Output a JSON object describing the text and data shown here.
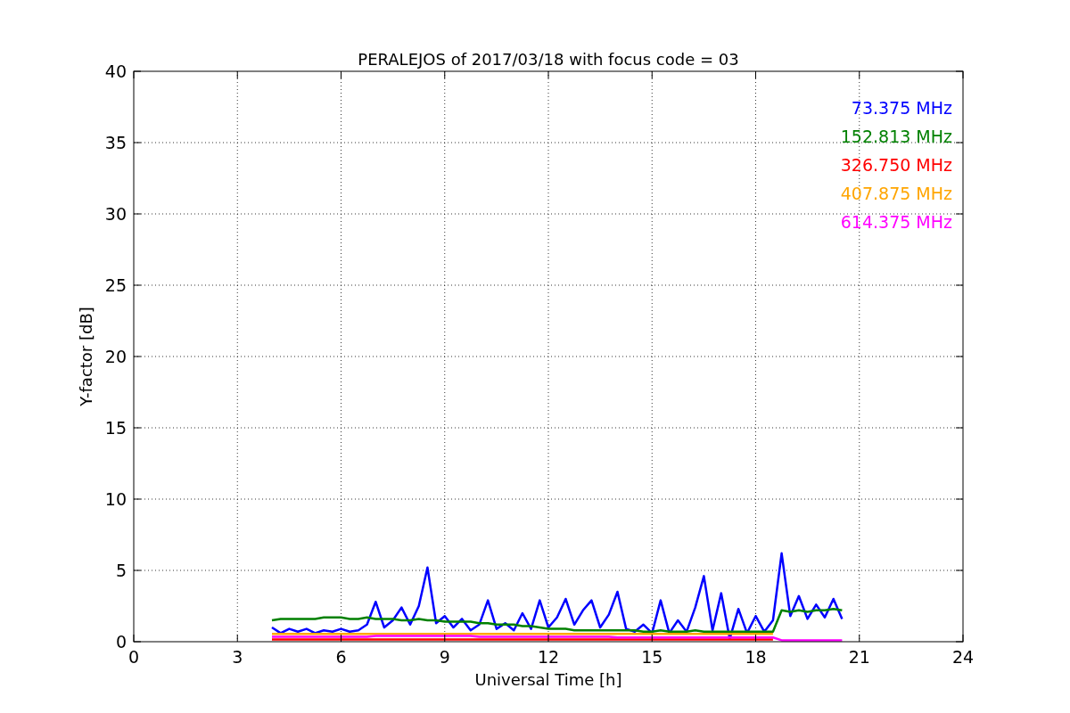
{
  "figure": {
    "chart_data": {
      "type": "line",
      "title": "PERALEJOS of 2017/03/18 with focus code = 03",
      "xlabel": "Universal Time [h]",
      "ylabel": "Y-factor [dB]",
      "x": [
        4,
        4.25,
        4.5,
        4.75,
        5,
        5.25,
        5.5,
        5.75,
        6,
        6.25,
        6.5,
        6.75,
        7,
        7.25,
        7.5,
        7.75,
        8,
        8.25,
        8.5,
        8.75,
        9,
        9.25,
        9.5,
        9.75,
        10,
        10.25,
        10.5,
        10.75,
        11,
        11.25,
        11.5,
        11.75,
        12,
        12.25,
        12.5,
        12.75,
        13,
        13.25,
        13.5,
        13.75,
        14,
        14.25,
        14.5,
        14.75,
        15,
        15.25,
        15.5,
        15.75,
        16,
        16.25,
        16.5,
        16.75,
        17,
        17.25,
        17.5,
        17.75,
        18,
        18.25,
        18.5,
        18.75,
        19,
        19.25,
        19.5,
        19.75,
        20,
        20.25,
        20.5
      ],
      "series": [
        {
          "name": "73.375 MHz",
          "color": "#0000ff",
          "values": [
            1.0,
            0.6,
            0.9,
            0.7,
            0.9,
            0.6,
            0.8,
            0.7,
            0.9,
            0.7,
            0.8,
            1.2,
            2.8,
            1.0,
            1.5,
            2.4,
            1.2,
            2.5,
            5.2,
            1.3,
            1.8,
            1.0,
            1.6,
            0.8,
            1.2,
            2.9,
            0.9,
            1.3,
            0.8,
            2.0,
            0.9,
            2.9,
            1.0,
            1.7,
            3.0,
            1.2,
            2.2,
            2.9,
            1.0,
            1.9,
            3.5,
            0.9,
            0.7,
            1.2,
            0.6,
            2.9,
            0.6,
            1.5,
            0.7,
            2.4,
            4.6,
            0.8,
            3.4,
            0.2,
            2.3,
            0.6,
            1.8,
            0.7,
            1.5,
            6.2,
            1.8,
            3.2,
            1.6,
            2.6,
            1.7,
            3.0,
            1.6
          ]
        },
        {
          "name": "152.813 MHz",
          "color": "#008000",
          "values": [
            1.5,
            1.6,
            1.6,
            1.6,
            1.6,
            1.6,
            1.7,
            1.7,
            1.7,
            1.6,
            1.6,
            1.7,
            1.6,
            1.6,
            1.6,
            1.5,
            1.5,
            1.6,
            1.5,
            1.5,
            1.4,
            1.4,
            1.4,
            1.4,
            1.3,
            1.3,
            1.2,
            1.2,
            1.2,
            1.1,
            1.1,
            1.0,
            0.9,
            0.9,
            0.9,
            0.8,
            0.8,
            0.8,
            0.8,
            0.8,
            0.8,
            0.8,
            0.8,
            0.7,
            0.7,
            0.8,
            0.7,
            0.7,
            0.7,
            0.8,
            0.7,
            0.7,
            0.7,
            0.7,
            0.7,
            0.7,
            0.7,
            0.7,
            0.7,
            2.2,
            2.1,
            2.2,
            2.1,
            2.2,
            2.2,
            2.3,
            2.2
          ]
        },
        {
          "name": "326.750 MHz",
          "color": "#ff0000",
          "values": [
            0.15,
            0.15,
            0.15,
            0.15,
            0.15,
            0.15,
            0.15,
            0.15,
            0.15,
            0.15,
            0.15,
            0.15,
            0.15,
            0.15,
            0.15,
            0.15,
            0.15,
            0.15,
            0.15,
            0.15,
            0.15,
            0.15,
            0.15,
            0.15,
            0.15,
            0.15,
            0.15,
            0.15,
            0.15,
            0.15,
            0.15,
            0.15,
            0.15,
            0.15,
            0.15,
            0.15,
            0.15,
            0.15,
            0.15,
            0.15,
            0.15,
            0.15,
            0.15,
            0.15,
            0.15,
            0.15,
            0.15,
            0.15,
            0.15,
            0.15,
            0.15,
            0.15,
            0.15,
            0.15,
            0.15,
            0.15,
            0.15,
            0.15,
            0.15,
            null,
            null,
            null,
            null,
            null,
            null,
            null,
            null
          ]
        },
        {
          "name": "407.875 MHz",
          "color": "#ffa500",
          "values": [
            0.55,
            0.55,
            0.55,
            0.55,
            0.55,
            0.55,
            0.55,
            0.55,
            0.55,
            0.55,
            0.55,
            0.55,
            0.55,
            0.55,
            0.55,
            0.55,
            0.55,
            0.55,
            0.55,
            0.55,
            0.55,
            0.55,
            0.55,
            0.55,
            0.55,
            0.55,
            0.55,
            0.55,
            0.55,
            0.55,
            0.55,
            0.55,
            0.55,
            0.55,
            0.55,
            0.55,
            0.55,
            0.55,
            0.55,
            0.55,
            0.55,
            0.55,
            0.55,
            0.55,
            0.55,
            0.55,
            0.55,
            0.55,
            0.55,
            0.55,
            0.55,
            0.55,
            0.55,
            0.55,
            0.55,
            0.55,
            0.55,
            0.55,
            0.55,
            null,
            null,
            null,
            null,
            null,
            null,
            null,
            null
          ]
        },
        {
          "name": "614.375 MHz",
          "color": "#ff00ff",
          "values": [
            0.35,
            0.35,
            0.35,
            0.35,
            0.35,
            0.35,
            0.35,
            0.35,
            0.35,
            0.35,
            0.35,
            0.35,
            0.4,
            0.4,
            0.4,
            0.4,
            0.4,
            0.4,
            0.4,
            0.4,
            0.4,
            0.4,
            0.4,
            0.4,
            0.35,
            0.35,
            0.35,
            0.35,
            0.35,
            0.35,
            0.35,
            0.35,
            0.35,
            0.35,
            0.35,
            0.35,
            0.35,
            0.35,
            0.35,
            0.35,
            0.3,
            0.3,
            0.3,
            0.3,
            0.3,
            0.3,
            0.3,
            0.3,
            0.3,
            0.3,
            0.3,
            0.3,
            0.3,
            0.3,
            0.3,
            0.3,
            0.3,
            0.3,
            0.3,
            0.1,
            0.1,
            0.1,
            0.1,
            0.1,
            0.1,
            0.1,
            0.1
          ]
        }
      ],
      "grid": true,
      "xlim": [
        0,
        24
      ],
      "ylim": [
        0,
        40
      ],
      "xticks": [
        0,
        3,
        6,
        9,
        12,
        15,
        18,
        21,
        24
      ],
      "yticks": [
        0,
        5,
        10,
        15,
        20,
        25,
        30,
        35,
        40
      ]
    }
  }
}
